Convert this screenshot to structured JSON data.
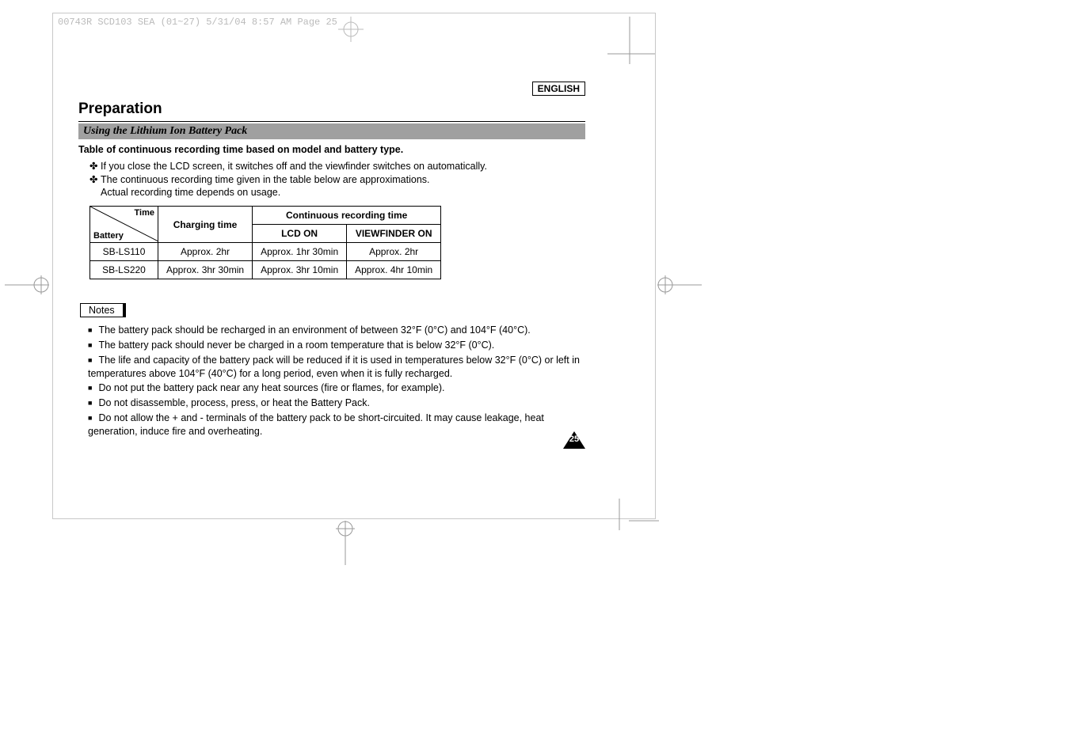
{
  "ghost_header": "00743R SCD103 SEA (01~27)  5/31/04 8:57 AM  Page 25",
  "language_badge": "ENGLISH",
  "title": "Preparation",
  "subtitle": "Using the Lithium Ion Battery Pack",
  "subheading": "Table of continuous recording time based on model and battery type.",
  "intro_items": [
    "If you close the LCD screen, it switches off and the viewfinder switches on automatically.",
    "The continuous recording time given in the table below are approximations."
  ],
  "intro_sub": "Actual recording time depends on usage.",
  "table": {
    "diag_top": "Time",
    "diag_bottom": "Battery",
    "col_charging": "Charging time",
    "col_group": "Continuous recording time",
    "col_lcd": "LCD ON",
    "col_vf": "VIEWFINDER ON",
    "rows": [
      {
        "battery": "SB-LS110",
        "charging": "Approx. 2hr",
        "lcd": "Approx. 1hr 30min",
        "vf": "Approx. 2hr"
      },
      {
        "battery": "SB-LS220",
        "charging": "Approx. 3hr 30min",
        "lcd": "Approx. 3hr 10min",
        "vf": "Approx. 4hr 10min"
      }
    ]
  },
  "notes_label": "Notes",
  "notes": [
    "The battery pack should be recharged in an environment of between 32°F (0°C) and 104°F (40°C).",
    "The battery pack should never be charged in a room temperature that is below 32°F (0°C).",
    "The life and capacity of the battery pack will be reduced if it is used in temperatures below 32°F (0°C) or left in temperatures above 104°F (40°C) for a long period, even when it is fully recharged.",
    "Do not put the battery pack near any heat sources (fire or flames, for example).",
    "Do not disassemble, process, press, or heat the Battery Pack.",
    "Do not allow the + and - terminals of the battery pack to be short-circuited. It may cause leakage, heat generation, induce fire and overheating."
  ],
  "page_number": "25"
}
